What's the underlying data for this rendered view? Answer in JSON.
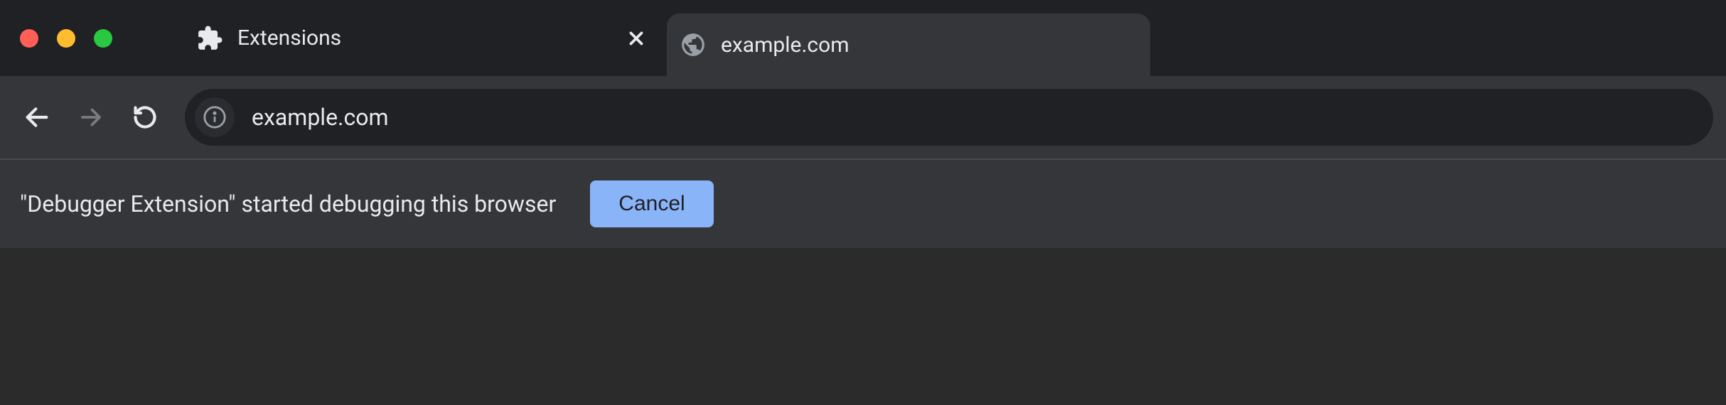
{
  "tabs": [
    {
      "title": "Extensions",
      "icon": "extension",
      "active": false
    },
    {
      "title": "example.com",
      "icon": "globe",
      "active": true
    }
  ],
  "toolbar": {
    "url": "example.com"
  },
  "infobar": {
    "message": "\"Debugger Extension\" started debugging this browser",
    "cancel_label": "Cancel"
  }
}
